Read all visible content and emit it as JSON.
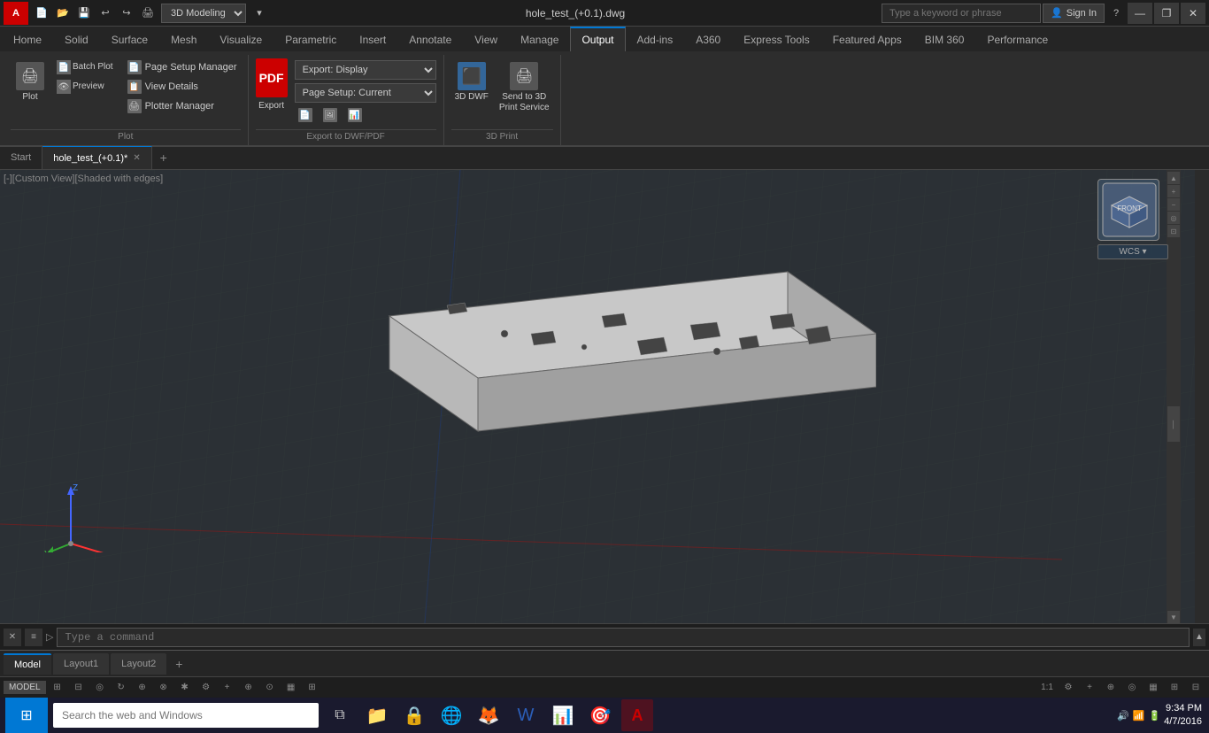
{
  "app": {
    "name": "AutoCAD",
    "logo": "A",
    "title": "hole_test_(+0.1).dwg",
    "workspace": "3D Modeling"
  },
  "titlebar": {
    "title": "hole_test_(+0.1).dwg",
    "search_placeholder": "Type a keyword or phrase",
    "sign_in": "Sign In",
    "minimize": "—",
    "restore": "❐",
    "close": "✕",
    "quick_access": [
      "↩",
      "↪",
      "⊞",
      "⊟",
      "⊜",
      "⊛"
    ]
  },
  "ribbon": {
    "tabs": [
      {
        "label": "Home",
        "active": false
      },
      {
        "label": "Solid",
        "active": false
      },
      {
        "label": "Surface",
        "active": false
      },
      {
        "label": "Mesh",
        "active": false
      },
      {
        "label": "Visualize",
        "active": false
      },
      {
        "label": "Parametric",
        "active": false
      },
      {
        "label": "Insert",
        "active": false
      },
      {
        "label": "Annotate",
        "active": false
      },
      {
        "label": "View",
        "active": false
      },
      {
        "label": "Manage",
        "active": false
      },
      {
        "label": "Output",
        "active": true
      },
      {
        "label": "Add-ins",
        "active": false
      },
      {
        "label": "A360",
        "active": false
      },
      {
        "label": "Express Tools",
        "active": false
      },
      {
        "label": "Featured Apps",
        "active": false
      },
      {
        "label": "BIM 360",
        "active": false
      },
      {
        "label": "Performance",
        "active": false
      }
    ],
    "groups": {
      "plot": {
        "label": "Plot",
        "buttons": [
          {
            "label": "Plot",
            "icon": "🖨"
          },
          {
            "label": "Batch\nPlot",
            "icon": "📄"
          },
          {
            "label": "Preview",
            "icon": "👁"
          }
        ],
        "small_buttons": [
          {
            "label": "Page Setup Manager"
          },
          {
            "label": "View Details"
          },
          {
            "label": "Plotter Manager"
          }
        ]
      },
      "export": {
        "label": "Export to DWF/PDF",
        "export_display": "Export: Display",
        "page_setup": "Page Setup: Current",
        "pdf_label": "PDF\nExport"
      },
      "print3d": {
        "label": "3D Print",
        "buttons": [
          {
            "label": "3D DWF",
            "icon": "⬛"
          },
          {
            "label": "Send to 3D\nPrint Service",
            "icon": "🖨"
          }
        ]
      }
    }
  },
  "doc_tabs": [
    {
      "label": "Start",
      "active": false,
      "closeable": false
    },
    {
      "label": "hole_test_(+0.1)*",
      "active": true,
      "closeable": true
    }
  ],
  "viewport": {
    "label": "[-][Custom View][Shaded with edges]",
    "background_color": "#2b3035"
  },
  "navcube": {
    "face_label": "FRONT",
    "wcs_label": "WCS ▾"
  },
  "layout_tabs": [
    {
      "label": "Model",
      "active": true
    },
    {
      "label": "Layout1",
      "active": false
    },
    {
      "label": "Layout2",
      "active": false
    }
  ],
  "statusbar": {
    "model_label": "MODEL",
    "scale": "1:1",
    "icons": [
      "⊞",
      "⊟",
      "◎",
      "↻",
      "↔",
      "↕",
      "⊕",
      "⊗",
      "✱",
      "⚙",
      "+",
      "⊕",
      "⊙",
      "▦",
      "⊞",
      "⊟"
    ]
  },
  "command": {
    "placeholder": "Type a command"
  },
  "taskbar": {
    "start_icon": "⊞",
    "search_placeholder": "Search the web and Windows",
    "apps": [
      "📁",
      "🔒",
      "🌐",
      "🦊",
      "📝",
      "📊",
      "🎯",
      "🅰"
    ],
    "clock": {
      "time": "9:34 PM",
      "date": "4/7/2016"
    }
  }
}
